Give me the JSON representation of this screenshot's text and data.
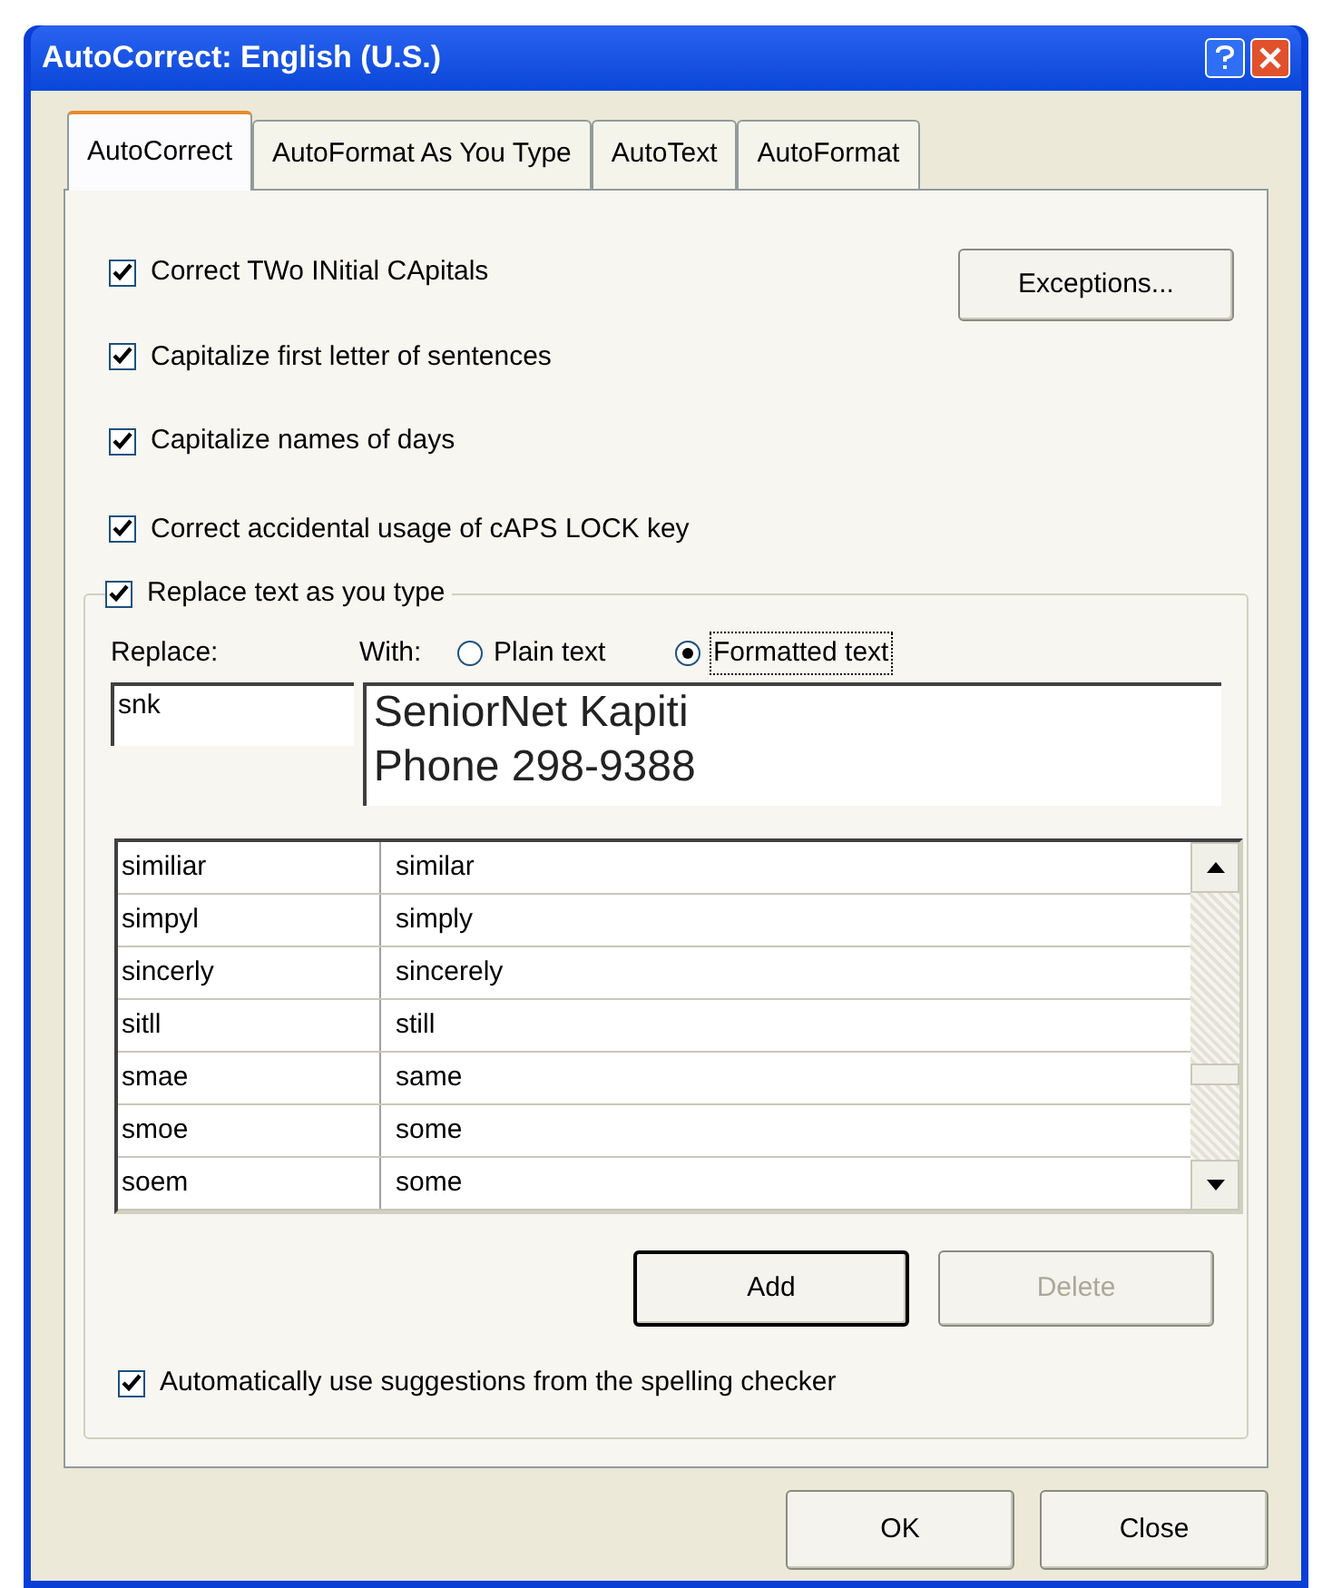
{
  "window": {
    "title": "AutoCorrect: English (U.S.)"
  },
  "tabs": [
    {
      "label": "AutoCorrect",
      "selected": true
    },
    {
      "label": "AutoFormat As You Type",
      "selected": false
    },
    {
      "label": "AutoText",
      "selected": false
    },
    {
      "label": "AutoFormat",
      "selected": false
    }
  ],
  "options": [
    {
      "label": "Correct TWo INitial CApitals",
      "checked": true
    },
    {
      "label": "Capitalize first letter of sentences",
      "checked": true
    },
    {
      "label": "Capitalize names of days",
      "checked": true
    },
    {
      "label": "Correct accidental usage of cAPS LOCK key",
      "checked": true
    }
  ],
  "exceptions_button": "Exceptions...",
  "replace_group": {
    "label": "Replace text as you type",
    "checked": true,
    "replace_label": "Replace:",
    "with_label": "With:",
    "formats": [
      {
        "label": "Plain text",
        "selected": false
      },
      {
        "label": "Formatted text",
        "selected": true
      }
    ],
    "replace_value": "snk",
    "with_lines": [
      "SeniorNet Kapiti",
      "Phone 298-9388"
    ],
    "entries": [
      {
        "from": "similiar",
        "to": "similar"
      },
      {
        "from": "simpyl",
        "to": "simply"
      },
      {
        "from": "sincerly",
        "to": "sincerely"
      },
      {
        "from": "sitll",
        "to": "still"
      },
      {
        "from": "smae",
        "to": "same"
      },
      {
        "from": "smoe",
        "to": "some"
      },
      {
        "from": "soem",
        "to": "some"
      }
    ],
    "buttons": [
      {
        "label": "Add",
        "disabled": false
      },
      {
        "label": "Delete",
        "disabled": true
      }
    ],
    "spelling_option": {
      "label": "Automatically use suggestions from the spelling checker",
      "checked": true
    }
  },
  "footer_buttons": [
    "OK",
    "Close"
  ]
}
